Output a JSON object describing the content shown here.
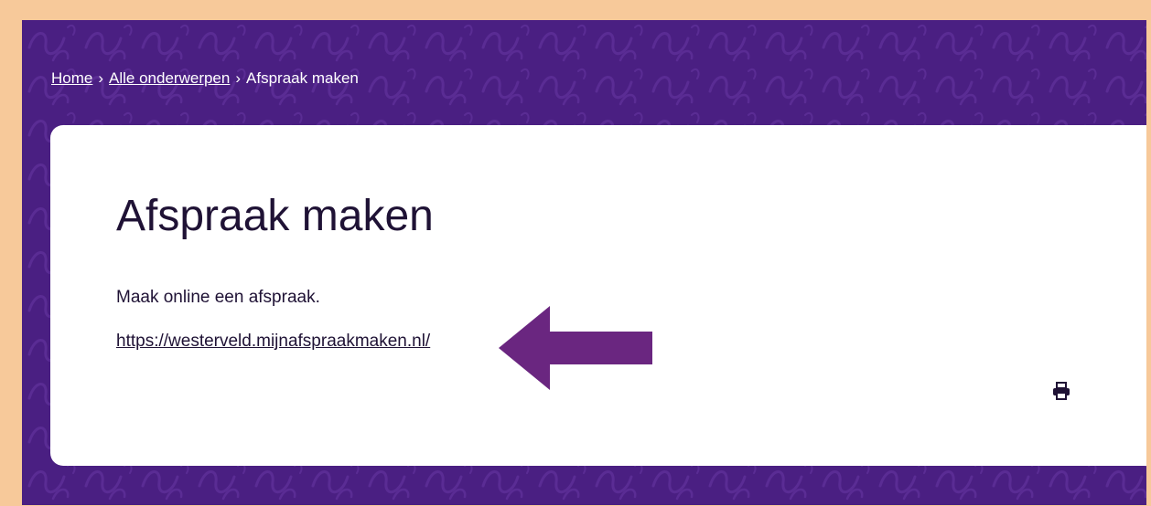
{
  "breadcrumb": {
    "items": [
      {
        "label": "Home"
      },
      {
        "label": "Alle onderwerpen"
      },
      {
        "label": "Afspraak maken"
      }
    ],
    "separator": "›"
  },
  "page": {
    "title": "Afspraak maken",
    "intro": "Maak online een afspraak.",
    "link_text": "https://westerveld.mijnafspraakmaken.nl/"
  },
  "icons": {
    "print": "print-icon",
    "arrow": "arrow-left-icon"
  },
  "colors": {
    "banner": "#4a1f82",
    "frame": "#f7c99a",
    "arrow": "#6a2680",
    "text": "#1f1235"
  }
}
